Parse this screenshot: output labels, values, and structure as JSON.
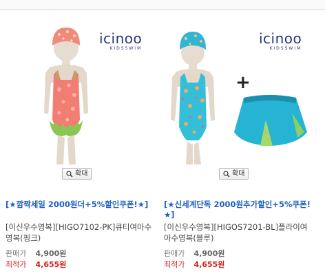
{
  "brand": {
    "name": "icinoo",
    "sub": "KIDSSWIM"
  },
  "zoom_label": "확대",
  "products": [
    {
      "promo": "[★깜짝세일 2000원더+5%할인쿠폰!★]",
      "title": "[이신우수영복][HIGO7102-PK]큐티여아수영복(핑크)",
      "price_label": "판매가",
      "price": "4,900원",
      "best_label": "최적가",
      "best_price": "4,655원"
    },
    {
      "promo": "[★신세계단독 2000원추가할인+5%쿠폰!★]",
      "title": "[이신우수영복][HIGOS7201-BL]플라이여아수영복(블루)",
      "price_label": "판매가",
      "price": "4,900원",
      "best_label": "최적가",
      "best_price": "4,655원"
    }
  ],
  "plus_sign": "+",
  "colors": {
    "promo": "#1f5fc4",
    "best_price": "#d41e1e",
    "brand": "#27367a"
  }
}
